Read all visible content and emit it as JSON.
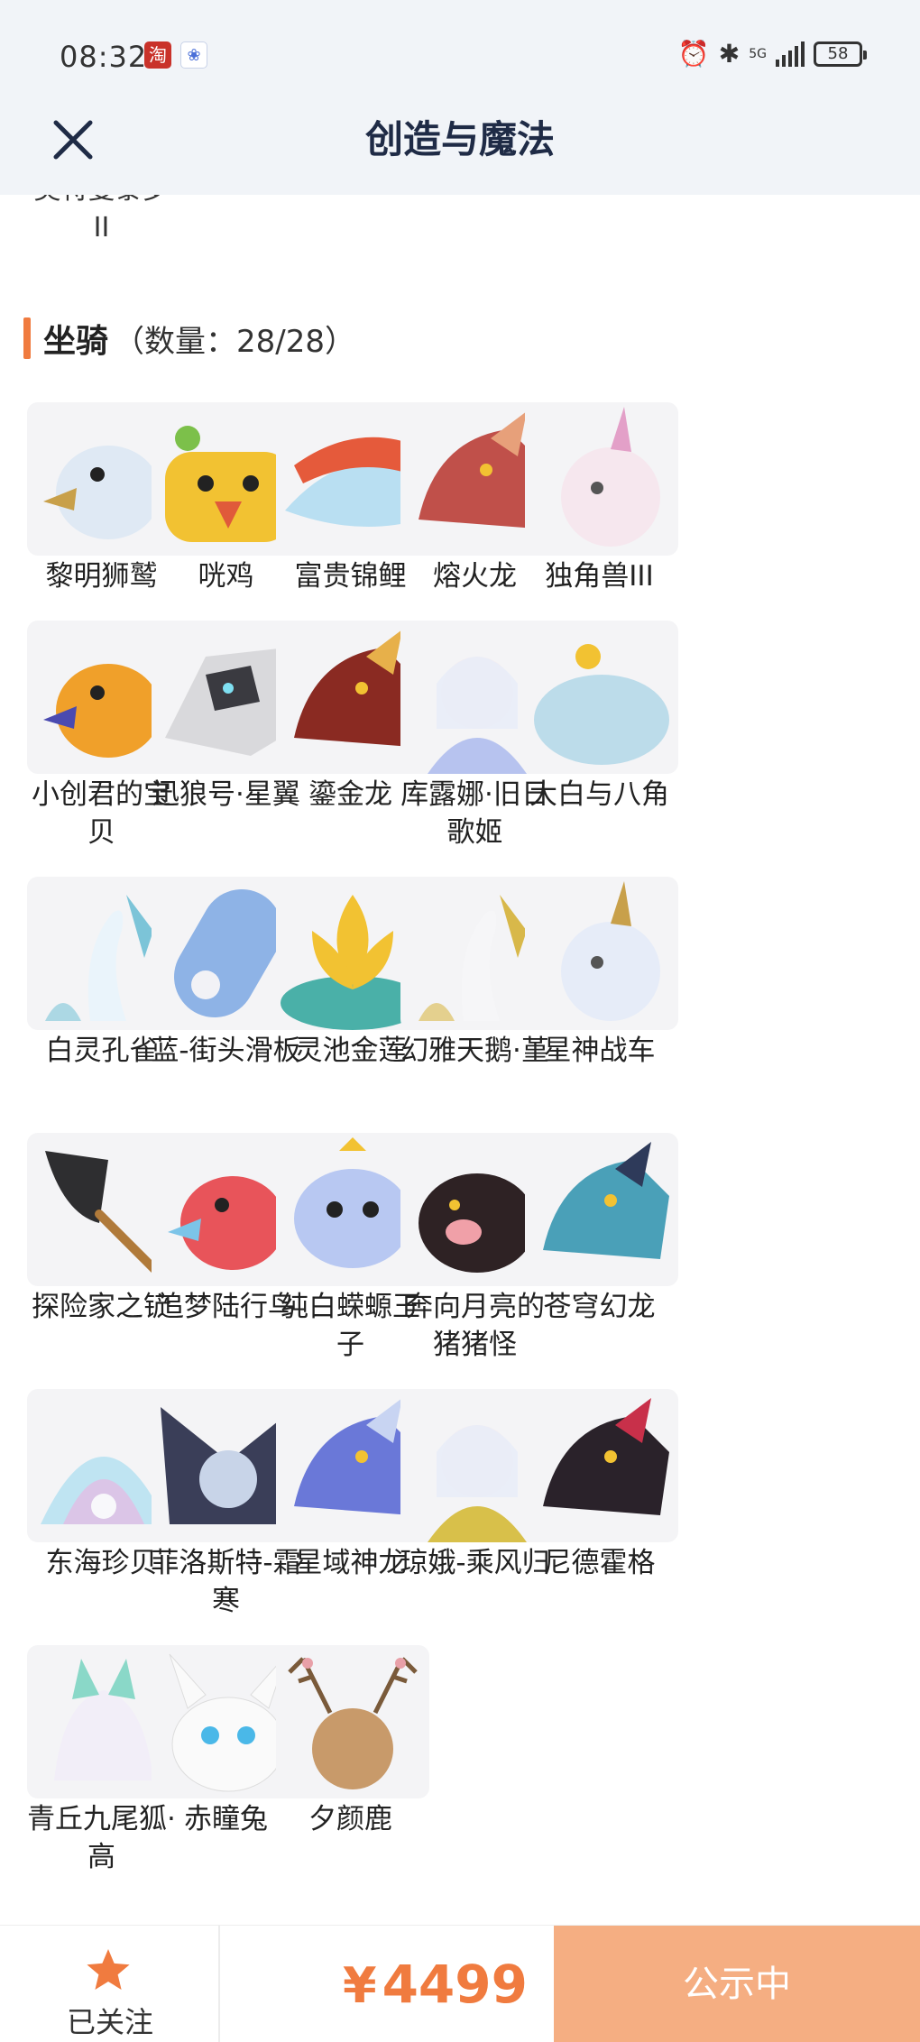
{
  "status_bar": {
    "time": "08:32",
    "app_badges": [
      "淘",
      "❀"
    ],
    "network": "5G",
    "battery": "58"
  },
  "header": {
    "title": "创造与魔法",
    "close_icon": "close-icon"
  },
  "previous_section": {
    "partial_item_label": "奥特曼泰罗\nII"
  },
  "section": {
    "title": "坐骑",
    "count_text": "（数量：28/28）"
  },
  "mounts": [
    {
      "label": "黎明狮鹫",
      "icon": "griffin",
      "colors": [
        "#dfe9f4",
        "#c8a04a"
      ]
    },
    {
      "label": "咣鸡",
      "icon": "chicken",
      "colors": [
        "#f2c232",
        "#7cc04a"
      ]
    },
    {
      "label": "富贵锦鲤",
      "icon": "koi",
      "colors": [
        "#e55a3b",
        "#b9dff2"
      ]
    },
    {
      "label": "熔火龙",
      "icon": "dragon",
      "colors": [
        "#c0504a",
        "#e7a07a"
      ]
    },
    {
      "label": "独角兽III",
      "icon": "unicorn",
      "colors": [
        "#f6e7ee",
        "#e3a0c8"
      ]
    },
    {
      "label": "小创君的宝贝",
      "icon": "phoenix",
      "colors": [
        "#f0a02a",
        "#4a4ab0"
      ]
    },
    {
      "label": "迅狼号·星翼",
      "icon": "mecha-wolf",
      "colors": [
        "#d9d9dc",
        "#3a3a40"
      ]
    },
    {
      "label": "鎏金龙",
      "icon": "dragon",
      "colors": [
        "#8a2a22",
        "#e7b04a"
      ]
    },
    {
      "label": "库露娜·旧日歌姬",
      "icon": "girl",
      "colors": [
        "#e7ecf8",
        "#b7c3ef"
      ]
    },
    {
      "label": "大白与八角",
      "icon": "whale",
      "colors": [
        "#bcdcea",
        "#f2c232"
      ]
    },
    {
      "label": "白灵孔雀",
      "icon": "peacock",
      "colors": [
        "#eaf4fb",
        "#7cc4d8"
      ]
    },
    {
      "label": "蓝-街头滑板",
      "icon": "skateboard",
      "colors": [
        "#8eb3e6",
        "#f2f2f6"
      ]
    },
    {
      "label": "灵池金莲",
      "icon": "lotus",
      "colors": [
        "#f2c232",
        "#4ab0a8"
      ]
    },
    {
      "label": "幻雅天鹅·堇",
      "icon": "swan",
      "colors": [
        "#f6f6f8",
        "#d8b84a"
      ]
    },
    {
      "label": "星神战车",
      "icon": "qilin",
      "colors": [
        "#e6ecf8",
        "#c8a04a"
      ]
    },
    {
      "label": "探险家之铲",
      "icon": "shovel",
      "colors": [
        "#2e2e30",
        "#b07a3a"
      ]
    },
    {
      "label": "追梦陆行鸟",
      "icon": "bird",
      "colors": [
        "#e8545a",
        "#7cc4e8"
      ]
    },
    {
      "label": "纯白蝾螈王子",
      "icon": "axolotl",
      "colors": [
        "#b8c8f2",
        "#f2c232"
      ]
    },
    {
      "label": "奔向月亮的猪猪怪",
      "icon": "pig",
      "colors": [
        "#2e2224",
        "#f0a0a8"
      ]
    },
    {
      "label": "苍穹幻龙",
      "icon": "dragon",
      "colors": [
        "#4aa0b8",
        "#2e3a5a"
      ]
    },
    {
      "label": "东海珍贝",
      "icon": "shell",
      "colors": [
        "#bfe4f2",
        "#e7b8e2"
      ]
    },
    {
      "label": "菲洛斯特-霜寒",
      "icon": "dark-angel",
      "colors": [
        "#3a3e58",
        "#c8d4e8"
      ]
    },
    {
      "label": "星域神龙",
      "icon": "dragon",
      "colors": [
        "#6a78d8",
        "#c8d4f2"
      ]
    },
    {
      "label": "琼娥-乘风归",
      "icon": "girl",
      "colors": [
        "#e7ecf8",
        "#d8c04a"
      ]
    },
    {
      "label": "尼德霍格",
      "icon": "dragon",
      "colors": [
        "#2a222a",
        "#c8304a"
      ]
    },
    {
      "label": "青丘九尾狐·高",
      "icon": "fox",
      "colors": [
        "#f2eef8",
        "#8ad8c8"
      ]
    },
    {
      "label": "赤瞳兔",
      "icon": "rabbit",
      "colors": [
        "#fafafa",
        "#4ab8e8"
      ]
    },
    {
      "label": "夕颜鹿",
      "icon": "deer",
      "colors": [
        "#c89a6a",
        "#e8a0a8"
      ]
    }
  ],
  "bottom_bar": {
    "follow_label": "已关注",
    "follow_icon": "star-icon",
    "price_currency": "¥",
    "price_value": "4499",
    "status_button": "公示中",
    "accent_color": "#f07b3f",
    "status_color": "#f5ae82"
  }
}
